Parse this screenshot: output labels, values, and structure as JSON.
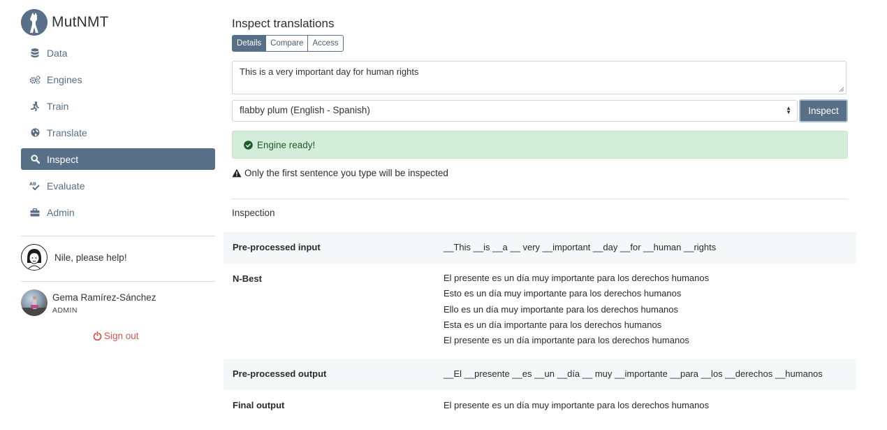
{
  "app": {
    "brand": "MutNMT"
  },
  "sidebar": {
    "items": [
      {
        "label": "Data",
        "icon": "database-icon"
      },
      {
        "label": "Engines",
        "icon": "gears-icon"
      },
      {
        "label": "Train",
        "icon": "running-icon"
      },
      {
        "label": "Translate",
        "icon": "globe-icon"
      },
      {
        "label": "Inspect",
        "icon": "search-icon",
        "active": true
      },
      {
        "label": "Evaluate",
        "icon": "spell-check-icon"
      },
      {
        "label": "Admin",
        "icon": "toolbox-icon"
      }
    ],
    "help": "Nile, please help!",
    "user": {
      "name": "Gema Ramírez-Sánchez",
      "role": "ADMIN"
    },
    "signout": "Sign out"
  },
  "main": {
    "title": "Inspect translations",
    "tabs": [
      "Details",
      "Compare",
      "Access"
    ],
    "active_tab": "Details",
    "input_text": "This is a very important day for human rights",
    "engine_select": "flabby plum (English - Spanish)",
    "inspect_button": "Inspect",
    "alert": "Engine ready!",
    "warning": "Only the first sentence you type will be inspected",
    "section_title": "Inspection"
  },
  "inspection": {
    "preprocessed_input": {
      "label": "Pre-processed input",
      "value": "__This __is __a __ very __important __day __for __human __rights"
    },
    "nbest": {
      "label": "N-Best",
      "values": [
        "El presente es un día muy importante para los derechos humanos",
        "Esto es un día muy importante para los derechos humanos",
        "Ello es un día muy importante para los derechos humanos",
        "Esta es un día importante para los derechos humanos",
        "El presente es un día importante para los derechos humanos"
      ]
    },
    "preprocessed_output": {
      "label": "Pre-processed output",
      "value": "__El __presente __es __un __día __ muy __importante __para __los __derechos __humanos"
    },
    "final_output": {
      "label": "Final output",
      "value": "El presente es un día muy importante para los derechos humanos"
    }
  },
  "colors": {
    "accent": "#587087",
    "nav_text": "#5a6f85",
    "success_bg": "#d4edda",
    "danger": "#d9534f"
  }
}
